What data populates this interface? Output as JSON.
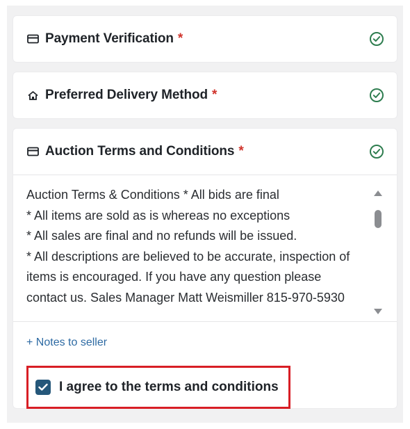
{
  "sections": [
    {
      "title": "Payment Verification",
      "required_mark": "*",
      "icon": "card-icon",
      "status": "complete"
    },
    {
      "title": "Preferred Delivery Method",
      "required_mark": "*",
      "icon": "home-icon",
      "status": "complete"
    },
    {
      "title": "Auction Terms and Conditions",
      "required_mark": "*",
      "icon": "card-icon",
      "status": "complete"
    }
  ],
  "terms": {
    "text": "Auction Terms & Conditions * All bids are final\n* All items are sold as is whereas no exceptions\n* All sales are final and no refunds will be issued.\n* All descriptions are believed to be accurate, inspection of items is encouraged. If you have any question please contact us. Sales Manager Matt Weismiller 815-970-5930"
  },
  "notes_link": "+ Notes to seller",
  "agree": {
    "label": "I agree to the terms and conditions",
    "checked": true
  },
  "colors": {
    "required": "#d0342c",
    "check_green": "#2e7d4f",
    "checkbox": "#25577a",
    "link": "#2d6aa3",
    "highlight": "#d81e25"
  }
}
